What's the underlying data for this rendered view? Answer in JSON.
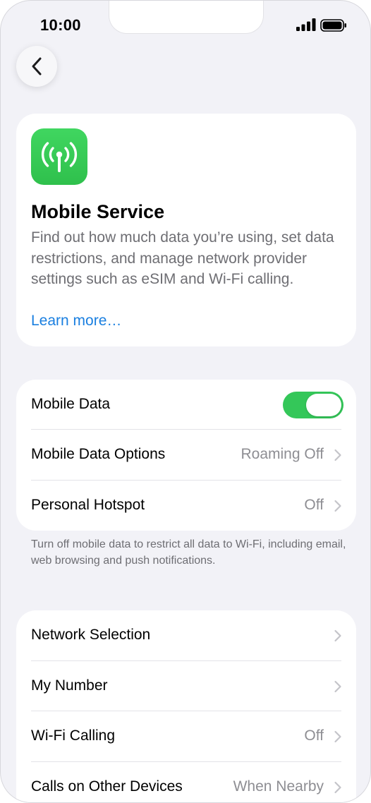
{
  "status_bar": {
    "time": "10:00",
    "signal_icon": "cellular-signal-icon",
    "battery_icon": "battery-full-icon"
  },
  "nav": {
    "back_icon": "chevron-left-icon"
  },
  "intro": {
    "icon": "antenna-radiowaves-icon",
    "icon_color": "#34c759",
    "title": "Mobile Service",
    "description": "Find out how much data you’re using, set data restrictions, and manage network provider settings such as eSIM and Wi-Fi calling.",
    "learn_more": "Learn more…",
    "link_color": "#1a7fe0"
  },
  "data_section": {
    "rows": [
      {
        "label": "Mobile Data",
        "toggle_on": true
      },
      {
        "label": "Mobile Data Options",
        "value": "Roaming Off"
      },
      {
        "label": "Personal Hotspot",
        "value": "Off"
      }
    ],
    "footnote": "Turn off mobile data to restrict all data to Wi-Fi, including email, web browsing and push notifications."
  },
  "network_section": {
    "rows": [
      {
        "label": "Network Selection",
        "value": ""
      },
      {
        "label": "My Number",
        "value": ""
      },
      {
        "label": "Wi-Fi Calling",
        "value": "Off"
      },
      {
        "label": "Calls on Other Devices",
        "value": "When Nearby"
      }
    ]
  },
  "colors": {
    "background": "#f2f2f7",
    "toggle_on": "#34c759",
    "secondary_text": "#8e8e93"
  }
}
